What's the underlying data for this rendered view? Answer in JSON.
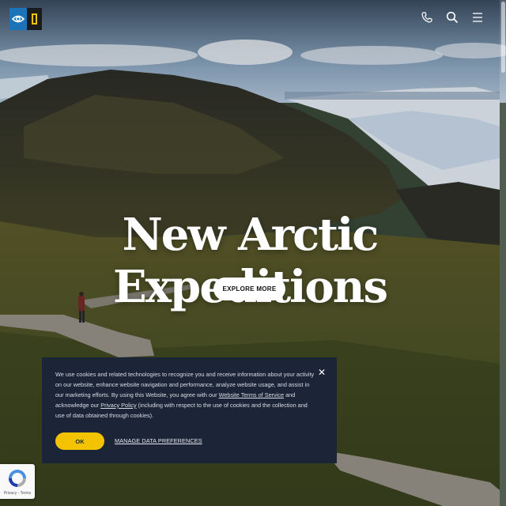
{
  "header": {
    "logo": "national-geographic-lindblad-logo",
    "icons": [
      "phone-icon",
      "search-icon",
      "menu-icon"
    ]
  },
  "hero": {
    "title": "New Arctic Expeditions",
    "button_label": "EXPLORE MORE"
  },
  "cookie_banner": {
    "text_before_link1": "We use cookies and related technologies to recognize you and receive information about your activity on our website, enhance website navigation and performance, analyze website usage, and assist in our marketing efforts. By using this Website, you agree with our ",
    "link1": "Website Terms of Service",
    "text_between": " and acknowledge our ",
    "link2": "Privacy Policy",
    "text_after": " (including with respect to the use of cookies and the collection and use of data obtained through cookies).",
    "ok_label": "OK",
    "manage_label": "MANAGE DATA PREFERENCES",
    "close_icon": "close-icon"
  },
  "recaptcha": {
    "text": "Privacy - Terms"
  },
  "colors": {
    "accent": "#f3c200",
    "banner_bg": "#1c2538",
    "logo_blue": "#1d73b8"
  }
}
